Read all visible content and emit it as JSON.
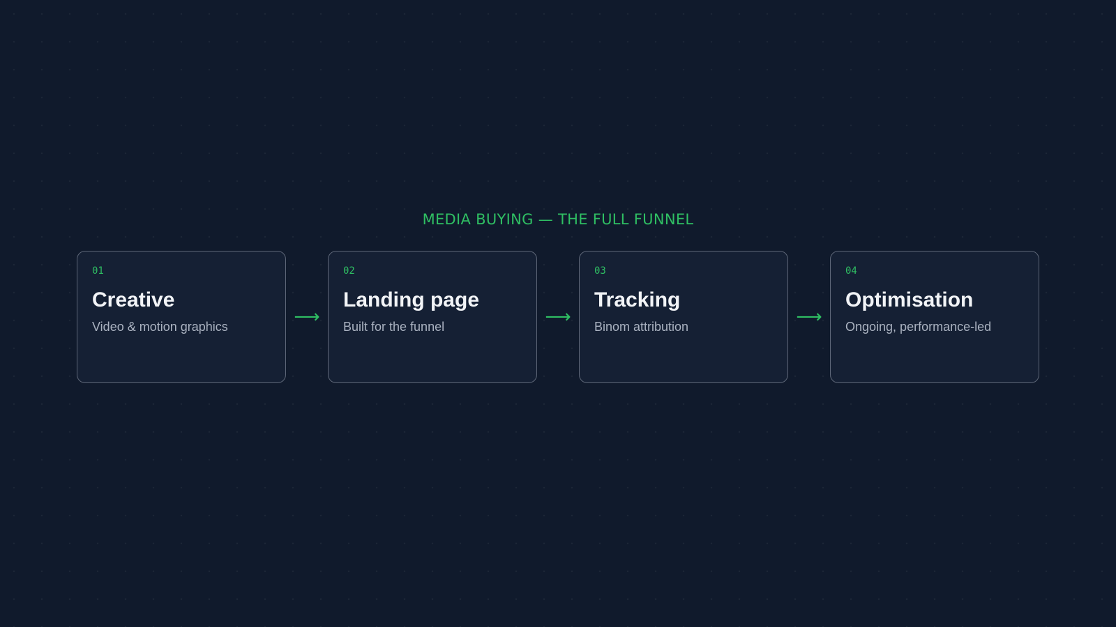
{
  "title": "MEDIA BUYING — THE FULL FUNNEL",
  "arrow_glyph": "⟶",
  "colors": {
    "background": "#101a2c",
    "card_background": "#152034",
    "card_border": "#5e6778",
    "accent": "#2fbf63",
    "title_text": "#f2f4f7",
    "description_text": "#aab2c0"
  },
  "stages": [
    {
      "number": "01",
      "title": "Creative",
      "description": "Video & motion graphics"
    },
    {
      "number": "02",
      "title": "Landing page",
      "description": "Built for the funnel"
    },
    {
      "number": "03",
      "title": "Tracking",
      "description": "Binom attribution"
    },
    {
      "number": "04",
      "title": "Optimisation",
      "description": "Ongoing, performance-led"
    }
  ]
}
